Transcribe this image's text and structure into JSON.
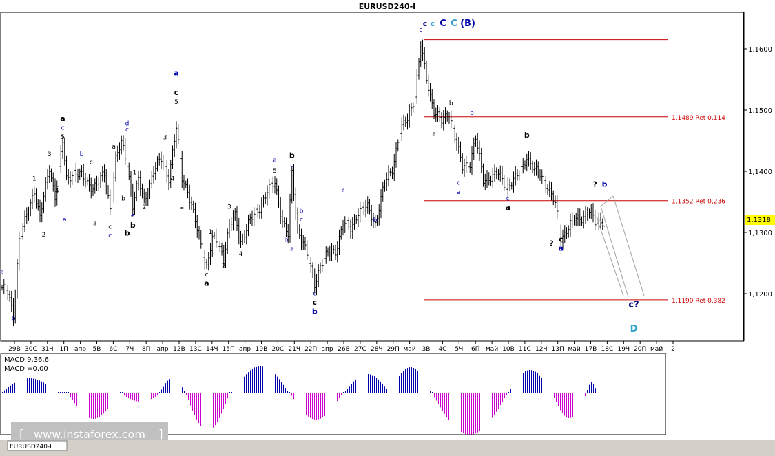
{
  "chart_data": {
    "type": "candlestick",
    "title": "EURUSD240-I",
    "price_axis": {
      "ticks": [
        {
          "label": "1,1600",
          "value": 1.16
        },
        {
          "label": "1,1500",
          "value": 1.15
        },
        {
          "label": "1,1400",
          "value": 1.14
        },
        {
          "label": "1,1300",
          "value": 1.13
        },
        {
          "label": "1,1200",
          "value": 1.12
        }
      ],
      "current_price": {
        "label": "1,1318",
        "value": 1.1318,
        "color": "#ffff00"
      }
    },
    "time_axis": {
      "ticks": [
        "29В",
        "30С",
        "31Ч",
        "1П",
        "апр",
        "5В",
        "6С",
        "7Ч",
        "8П",
        "апр",
        "12В",
        "13С",
        "14Ч",
        "15П",
        "апр",
        "19В",
        "20С",
        "21Ч",
        "22П",
        "апр",
        "26В",
        "27С",
        "28Ч",
        "29П",
        "май",
        "3В",
        "4С",
        "5Ч",
        "6П",
        "май",
        "10В",
        "11С",
        "12Ч",
        "13П",
        "май",
        "17В",
        "18С",
        "19Ч",
        "20П",
        "май",
        "2"
      ]
    },
    "levels": [
      {
        "value": 1.1615,
        "label": ""
      },
      {
        "value": 1.1489,
        "label": "1,1489 Ret 0,114"
      },
      {
        "value": 1.1352,
        "label": "1,1352 Ret 0,236"
      },
      {
        "value": 1.119,
        "label": "1,1190 Ret 0,382"
      }
    ],
    "level_color": "#cc0000",
    "wave_labels": [
      {
        "text": "a",
        "bar": 0,
        "price": 1.1232,
        "color": "#0000aa",
        "size": "s"
      },
      {
        "text": "b",
        "bar": 6,
        "price": 1.1157,
        "color": "#0000aa",
        "size": "s"
      },
      {
        "text": "1",
        "bar": 17,
        "price": 1.1385,
        "color": "#000000",
        "size": "s"
      },
      {
        "text": "2",
        "bar": 22,
        "price": 1.1293,
        "color": "#000000",
        "size": "s"
      },
      {
        "text": "3",
        "bar": 25,
        "price": 1.1425,
        "color": "#000000",
        "size": "s"
      },
      {
        "text": "a",
        "bar": 32,
        "price": 1.1482,
        "color": "#000000",
        "size": "m"
      },
      {
        "text": "c",
        "bar": 32,
        "price": 1.1468,
        "color": "#0000aa",
        "size": "s"
      },
      {
        "text": "5",
        "bar": 32,
        "price": 1.1453,
        "color": "#000000",
        "size": "s"
      },
      {
        "text": "4",
        "bar": 29,
        "price": 1.1365,
        "color": "#000000",
        "size": "s"
      },
      {
        "text": "a",
        "bar": 33,
        "price": 1.1318,
        "color": "#0000aa",
        "size": "s"
      },
      {
        "text": "b",
        "bar": 42,
        "price": 1.1425,
        "color": "#0000aa",
        "size": "s"
      },
      {
        "text": "c",
        "bar": 47,
        "price": 1.1412,
        "color": "#000000",
        "size": "s"
      },
      {
        "text": "a",
        "bar": 49,
        "price": 1.1312,
        "color": "#000000",
        "size": "s"
      },
      {
        "text": "c",
        "bar": 57,
        "price": 1.1306,
        "color": "#000000",
        "size": "s"
      },
      {
        "text": "c",
        "bar": 57,
        "price": 1.1292,
        "color": "#0000aa",
        "size": "s"
      },
      {
        "text": "b",
        "bar": 66,
        "price": 1.1295,
        "color": "#000000",
        "size": "m"
      },
      {
        "text": "a",
        "bar": 59,
        "price": 1.1437,
        "color": "#000000",
        "size": "s"
      },
      {
        "text": "d",
        "bar": 66,
        "price": 1.1475,
        "color": "#0000aa",
        "size": "s"
      },
      {
        "text": "c",
        "bar": 66,
        "price": 1.1465,
        "color": "#0000aa",
        "size": "s"
      },
      {
        "text": "b",
        "bar": 64,
        "price": 1.1352,
        "color": "#000000",
        "size": "s"
      },
      {
        "text": "e",
        "bar": 69,
        "price": 1.1325,
        "color": "#0000aa",
        "size": "s"
      },
      {
        "text": "b",
        "bar": 69,
        "price": 1.1308,
        "color": "#000000",
        "size": "m"
      },
      {
        "text": "1",
        "bar": 70,
        "price": 1.1395,
        "color": "#000000",
        "size": "s"
      },
      {
        "text": "2",
        "bar": 75,
        "price": 1.1338,
        "color": "#000000",
        "size": "s"
      },
      {
        "text": "3",
        "bar": 86,
        "price": 1.1452,
        "color": "#000000",
        "size": "s"
      },
      {
        "text": "a",
        "bar": 92,
        "price": 1.1557,
        "color": "#0000aa",
        "size": "m"
      },
      {
        "text": "c",
        "bar": 92,
        "price": 1.1525,
        "color": "#000000",
        "size": "m"
      },
      {
        "text": "5",
        "bar": 92,
        "price": 1.151,
        "color": "#000000",
        "size": "s"
      },
      {
        "text": "4",
        "bar": 90,
        "price": 1.1385,
        "color": "#000000",
        "size": "s"
      },
      {
        "text": "a",
        "bar": 95,
        "price": 1.1338,
        "color": "#000000",
        "size": "s"
      },
      {
        "text": "1",
        "bar": 110,
        "price": 1.1298,
        "color": "#000000",
        "size": "s"
      },
      {
        "text": "2",
        "bar": 117,
        "price": 1.1242,
        "color": "#000000",
        "size": "s"
      },
      {
        "text": "3",
        "bar": 120,
        "price": 1.1339,
        "color": "#000000",
        "size": "s"
      },
      {
        "text": "4",
        "bar": 126,
        "price": 1.1262,
        "color": "#000000",
        "size": "s"
      },
      {
        "text": "c",
        "bar": 108,
        "price": 1.1228,
        "color": "#000000",
        "size": "s"
      },
      {
        "text": "a",
        "bar": 108,
        "price": 1.1213,
        "color": "#000000",
        "size": "m"
      },
      {
        "text": "a",
        "bar": 144,
        "price": 1.1415,
        "color": "#0000aa",
        "size": "s"
      },
      {
        "text": "5",
        "bar": 144,
        "price": 1.1398,
        "color": "#000000",
        "size": "s"
      },
      {
        "text": "b",
        "bar": 153,
        "price": 1.1422,
        "color": "#000000",
        "size": "m"
      },
      {
        "text": "c",
        "bar": 153,
        "price": 1.1407,
        "color": "#0000aa",
        "size": "s"
      },
      {
        "text": "b",
        "bar": 158,
        "price": 1.1332,
        "color": "#0000aa",
        "size": "s"
      },
      {
        "text": "c",
        "bar": 158,
        "price": 1.1318,
        "color": "#0000aa",
        "size": "s"
      },
      {
        "text": "b",
        "bar": 150,
        "price": 1.1285,
        "color": "#0000aa",
        "size": "s"
      },
      {
        "text": "a",
        "bar": 153,
        "price": 1.127,
        "color": "#0000aa",
        "size": "s"
      },
      {
        "text": "c",
        "bar": 165,
        "price": 1.1197,
        "color": "#0000aa",
        "size": "s"
      },
      {
        "text": "c",
        "bar": 165,
        "price": 1.1182,
        "color": "#000000",
        "size": "m"
      },
      {
        "text": "b",
        "bar": 165,
        "price": 1.1167,
        "color": "#0000aa",
        "size": "m"
      },
      {
        "text": "a",
        "bar": 180,
        "price": 1.1367,
        "color": "#0000aa",
        "size": "s"
      },
      {
        "text": "b",
        "bar": 197,
        "price": 1.1317,
        "color": "#0000aa",
        "size": "s"
      },
      {
        "text": "c",
        "bar": 221,
        "price": 1.1628,
        "color": "#0000aa",
        "size": "s"
      },
      {
        "text": "a",
        "bar": 228,
        "price": 1.1458,
        "color": "#000000",
        "size": "s"
      },
      {
        "text": "b",
        "bar": 237,
        "price": 1.1508,
        "color": "#000000",
        "size": "s"
      },
      {
        "text": "b",
        "bar": 248,
        "price": 1.1492,
        "color": "#0000aa",
        "size": "s"
      },
      {
        "text": "c",
        "bar": 241,
        "price": 1.1378,
        "color": "#0000aa",
        "size": "s"
      },
      {
        "text": "a",
        "bar": 241,
        "price": 1.1363,
        "color": "#0000aa",
        "size": "s"
      },
      {
        "text": "c",
        "bar": 267,
        "price": 1.1352,
        "color": "#0000aa",
        "size": "s"
      },
      {
        "text": "a",
        "bar": 267,
        "price": 1.1337,
        "color": "#000000",
        "size": "m"
      },
      {
        "text": "b",
        "bar": 277,
        "price": 1.1455,
        "color": "#000000",
        "size": "m"
      },
      {
        "text": "c",
        "bar": 295,
        "price": 1.1285,
        "color": "#000000",
        "size": "m"
      },
      {
        "text": "?",
        "bar": 290,
        "price": 1.1278,
        "color": "#000000",
        "size": "m"
      },
      {
        "text": "a",
        "bar": 295,
        "price": 1.127,
        "color": "#0000aa",
        "size": "m"
      },
      {
        "text": "?",
        "bar": 313,
        "price": 1.1375,
        "color": "#000000",
        "size": "m"
      },
      {
        "text": "b",
        "bar": 318,
        "price": 1.1375,
        "color": "#0000aa",
        "size": "m"
      }
    ],
    "top_labels": [
      {
        "text": "c",
        "color": "#000080",
        "size": "m"
      },
      {
        "text": "c",
        "color": "#3399cc",
        "size": "m"
      },
      {
        "text": "C",
        "color": "#0000aa",
        "size": "l"
      },
      {
        "text": "C",
        "color": "#3399cc",
        "size": "l"
      },
      {
        "text": "(B)",
        "color": "#0000aa",
        "size": "l"
      }
    ],
    "projection_labels": [
      {
        "text": "c?",
        "price": 1.1185,
        "color": "#000080",
        "size": "l"
      },
      {
        "text": "D",
        "price": 1.1142,
        "color": "#33a0c8",
        "size": "l"
      }
    ],
    "indicator": {
      "name": "MACD 9,36,6",
      "value_label": "MACD =0,00",
      "positive_color": "#0000aa",
      "negative_color": "#cc00cc"
    },
    "grid": false,
    "watermark": "www.instaforex.com"
  },
  "bottom_tab": "EURUSD240-I"
}
